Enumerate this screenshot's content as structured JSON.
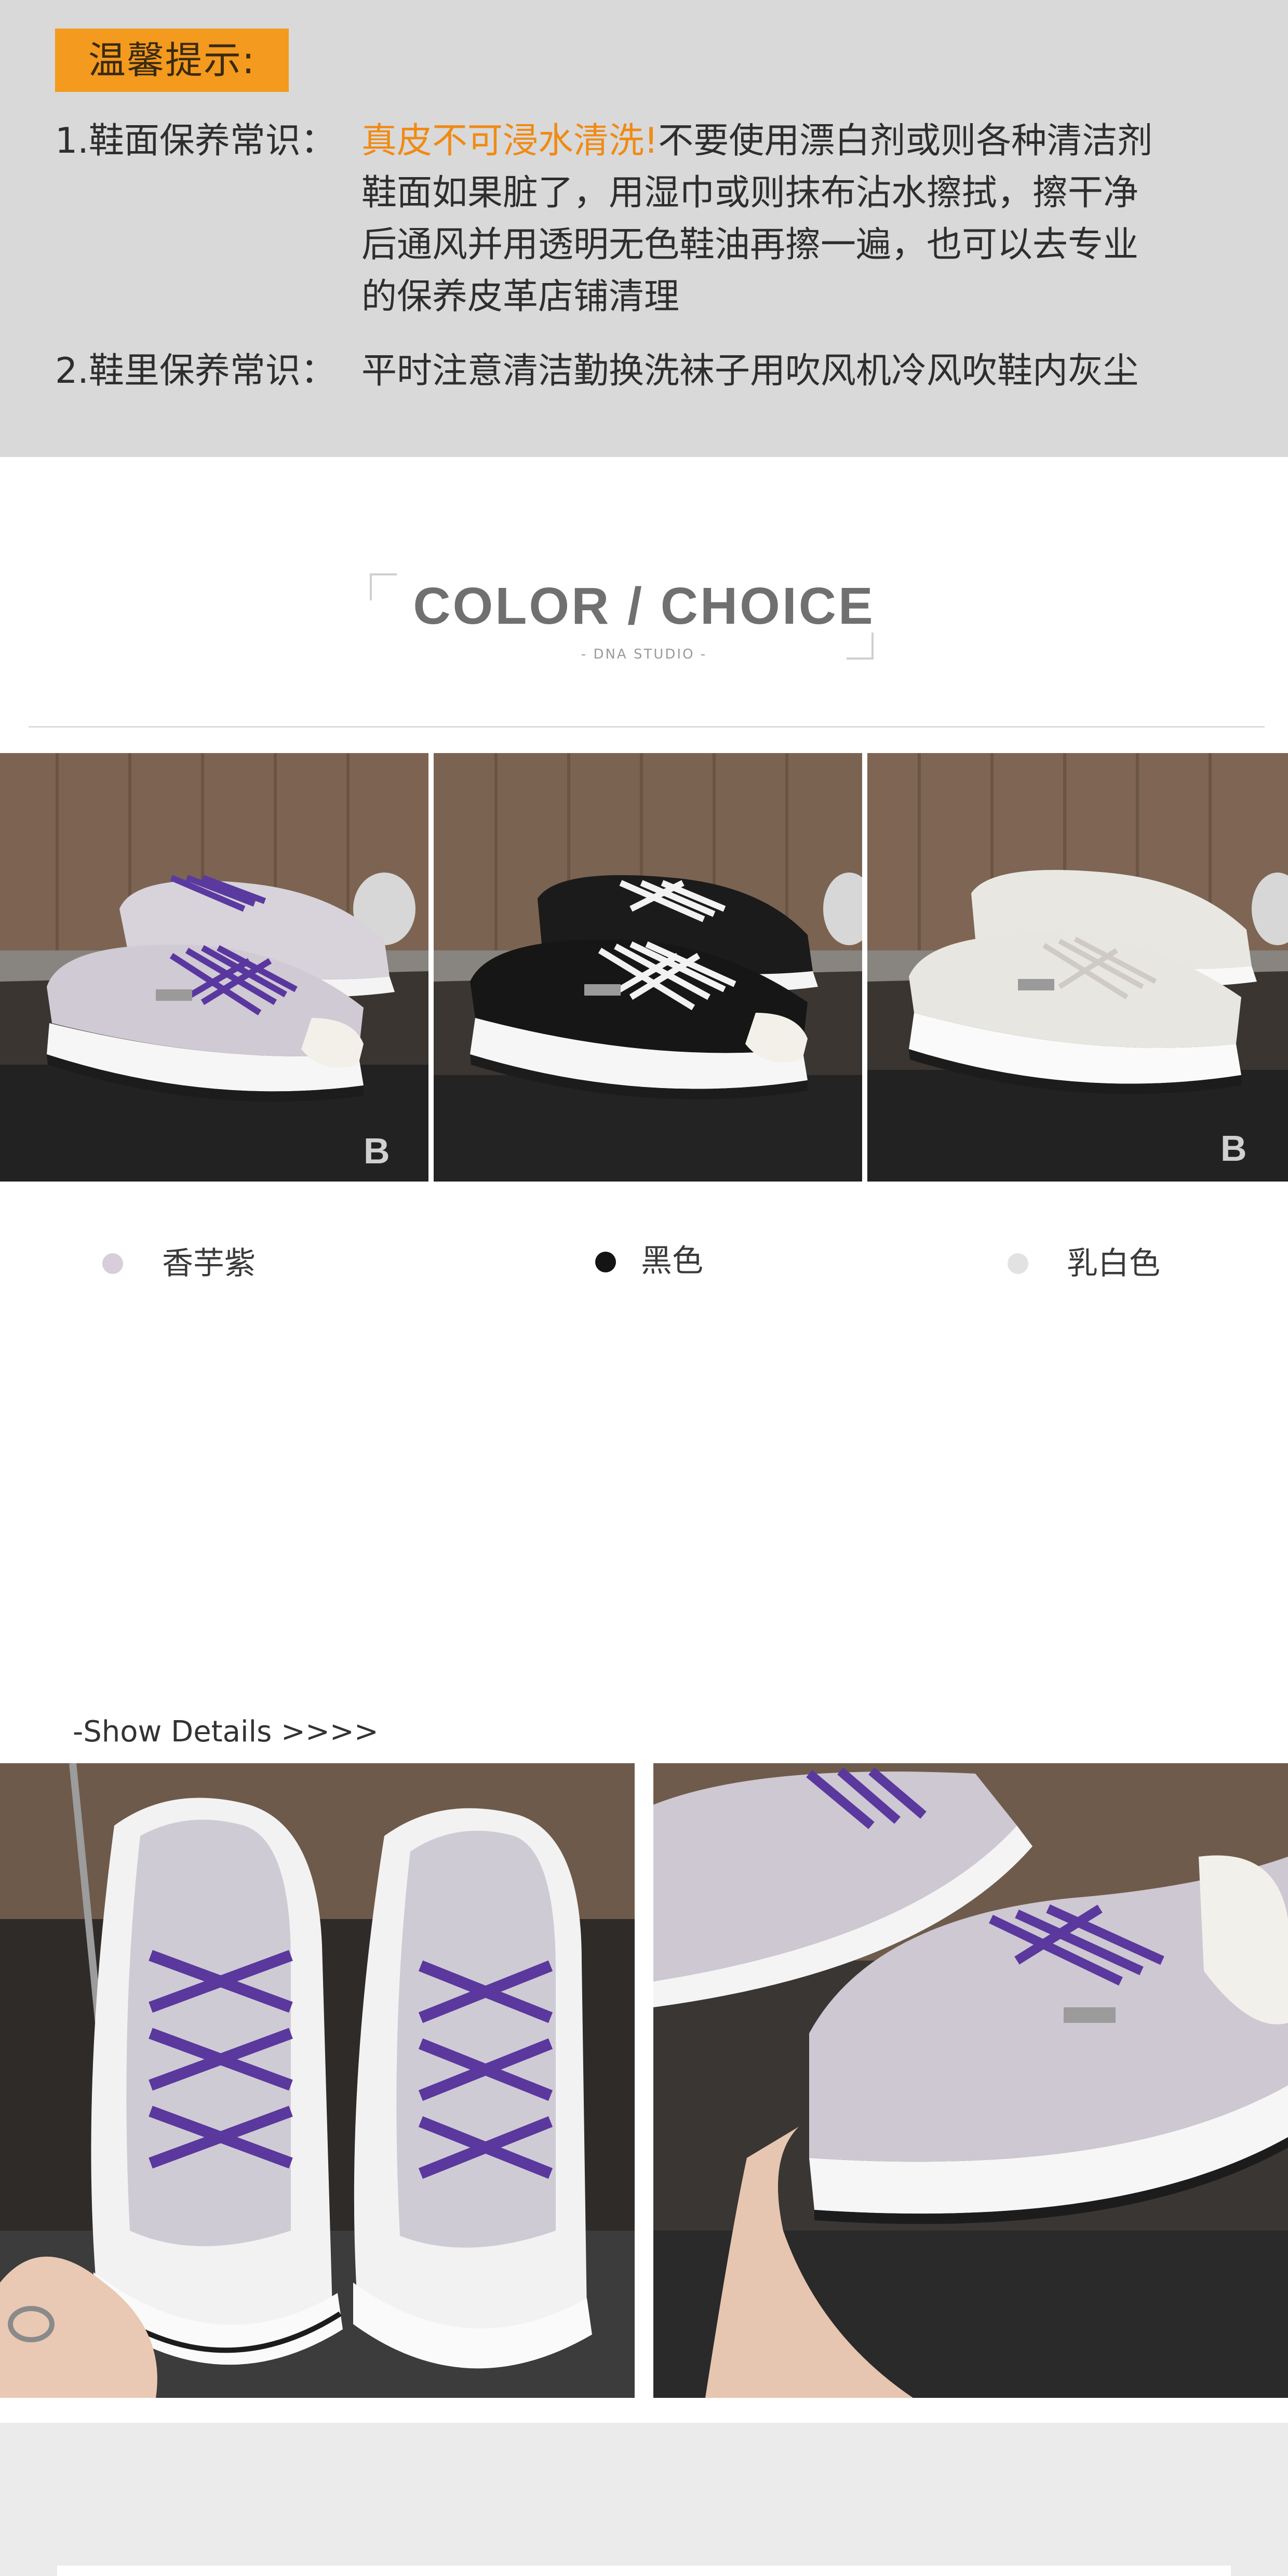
{
  "tips": {
    "badge": "温馨提示:",
    "items": [
      {
        "prefix": "1.鞋面保养常识：",
        "highlight": "真皮不可浸水清洗!",
        "line1_rest": "不要使用漂白剂或则各种清洁剂",
        "line2": "鞋面如果脏了，用湿巾或则抹布沾水擦拭，擦干净",
        "line3": "后通风并用透明无色鞋油再擦一遍，也可以去专业",
        "line4": "的保养皮革店铺清理"
      },
      {
        "prefix": "2.鞋里保养常识：",
        "body": "平时注意清洁勤换洗袜子用吹风机冷风吹鞋内灰尘"
      }
    ],
    "colors": {
      "badge": "#f39a1f",
      "highlight": "#f08a14",
      "panel": "#d9d9d9"
    }
  },
  "color_choice": {
    "title": "COLOR / CHOICE",
    "subtitle": "- DNA STUDIO -"
  },
  "swatches": [
    {
      "label": "香芋紫",
      "color": "#d8cdda"
    },
    {
      "label": "黑色",
      "color": "#141414"
    },
    {
      "label": "乳白色",
      "color": "#e2e2e2"
    }
  ],
  "details": {
    "heading": "-Show Details >>>>"
  }
}
